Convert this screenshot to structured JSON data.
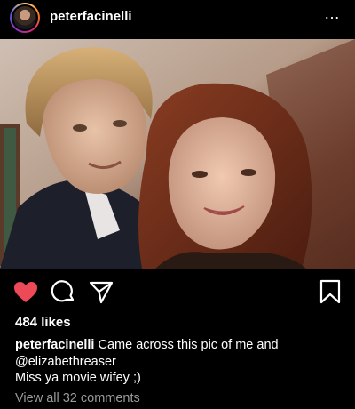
{
  "post": {
    "username": "peterfacinelli",
    "more_icon": "…",
    "likes": "484 likes",
    "caption_username": "peterfacinelli",
    "caption_text": "Came across this pic of me and @elizabethreaser",
    "caption_line2": "Miss ya movie wifey ;)",
    "view_comments": "View all 32 comments"
  },
  "icons": {
    "avatar": "profile-avatar",
    "more": "more-options-icon",
    "like": "heart-icon",
    "comment": "comment-icon",
    "share": "share-icon",
    "save": "bookmark-icon"
  },
  "colors": {
    "background": "#000000",
    "like_active": "#ed4956",
    "muted_text": "#9a9a9a"
  }
}
